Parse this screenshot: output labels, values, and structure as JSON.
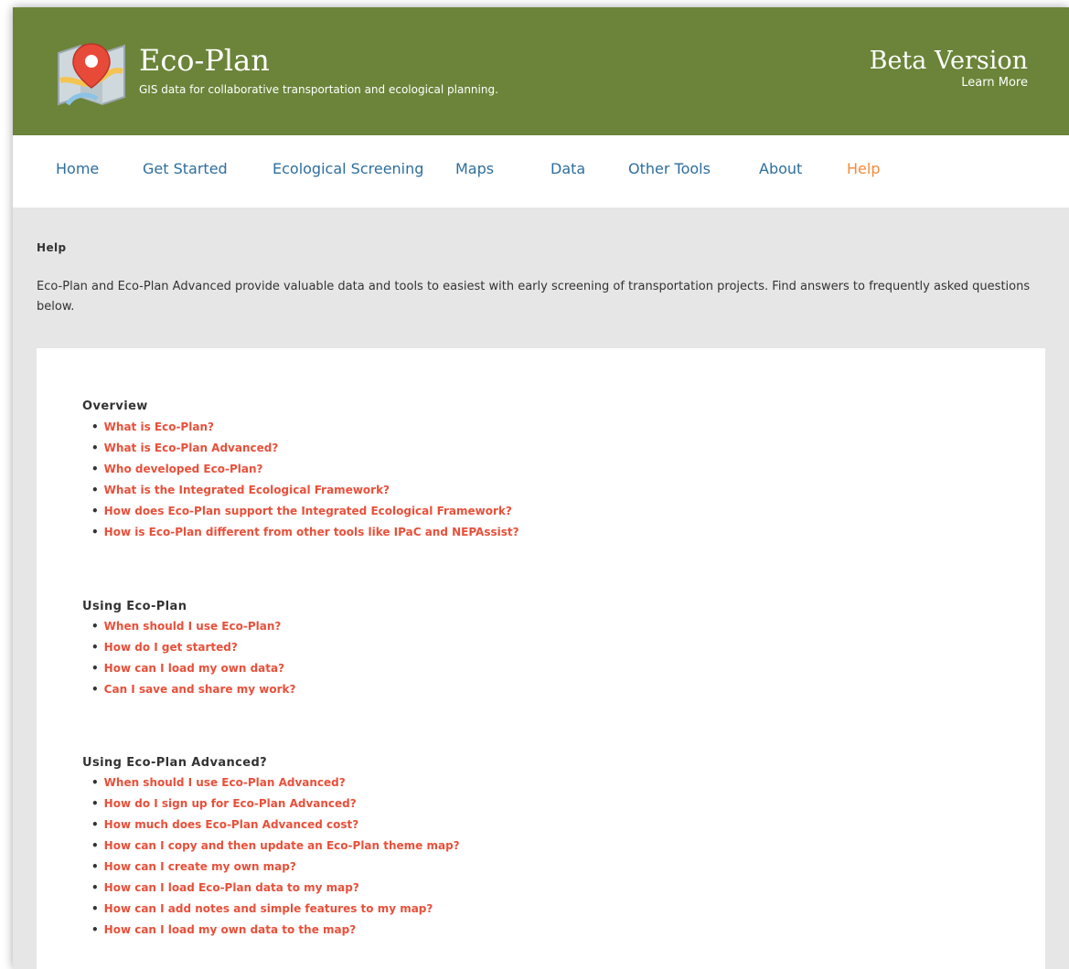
{
  "header": {
    "brand_title": "Eco-Plan",
    "tagline": "GIS data for collaborative transportation and ecological planning.",
    "beta_title": "Beta Version",
    "learn_more": "Learn More",
    "background_color": "#6b8439",
    "logo_icon": "map-pin-icon"
  },
  "nav": {
    "items": [
      {
        "label": "Home"
      },
      {
        "label": "Get Started"
      },
      {
        "label": "Ecological Screening"
      },
      {
        "label": "Maps"
      },
      {
        "label": "Data"
      },
      {
        "label": "Other Tools"
      },
      {
        "label": "About"
      },
      {
        "label": "Help"
      }
    ],
    "active": "Help",
    "link_color": "#2d6e9e",
    "active_color": "#f5893a"
  },
  "main": {
    "heading": "Help",
    "intro": "Eco-Plan and Eco-Plan Advanced provide valuable data and tools to easiest with early screening of transportation projects. Find answers to frequently asked questions below.",
    "link_color": "#e8503a",
    "sections": [
      {
        "title": "Overview",
        "items": [
          "What is Eco-Plan?",
          "What is Eco-Plan Advanced?",
          "Who developed Eco-Plan?",
          "What is the Integrated Ecological Framework?",
          "How does Eco-Plan support the Integrated Ecological Framework?",
          "How is Eco-Plan different from other tools like IPaC and NEPAssist?"
        ]
      },
      {
        "title": "Using Eco-Plan",
        "items": [
          "When should I use Eco-Plan?",
          "How do I get started?",
          "How can I load my own data?",
          "Can I save and share my work?"
        ]
      },
      {
        "title": "Using Eco-Plan Advanced?",
        "items": [
          "When should I use Eco-Plan Advanced?",
          "How do I sign up for Eco-Plan Advanced?",
          "How much does Eco-Plan Advanced cost?",
          "How can I copy and then update an Eco-Plan theme map?",
          "How can I create my own map?",
          "How can I load Eco-Plan data to my map?",
          "How can I add notes and simple features to my map?",
          "How can I load my own data to the map?"
        ]
      }
    ]
  }
}
